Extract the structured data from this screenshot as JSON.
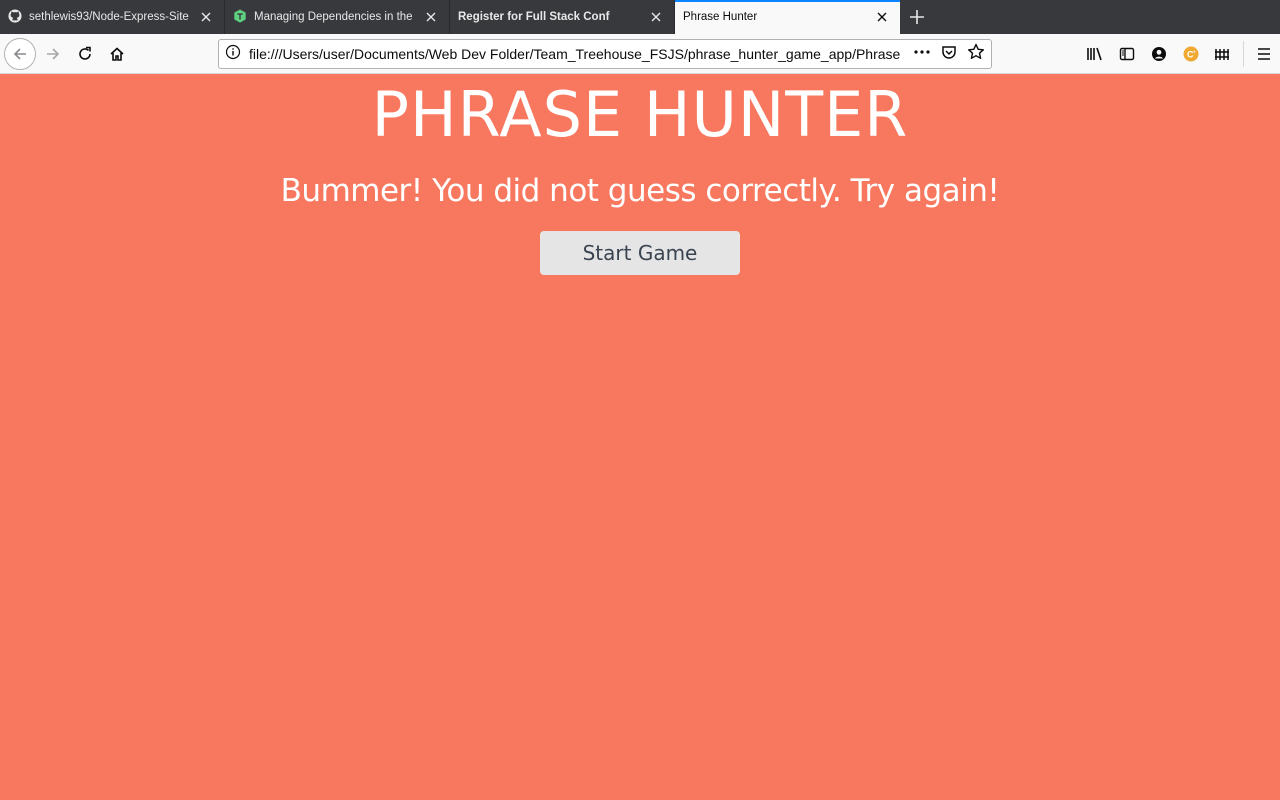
{
  "browser": {
    "tabs": [
      {
        "title": "sethlewis93/Node-Express-Site",
        "icon": "github-icon",
        "active": false,
        "bold": false
      },
      {
        "title": "Managing Dependencies in the",
        "icon": "treehouse-icon",
        "active": false,
        "bold": false
      },
      {
        "title": "Register for Full Stack Conf",
        "icon": "",
        "active": false,
        "bold": true
      },
      {
        "title": "Phrase Hunter",
        "icon": "",
        "active": true,
        "bold": false
      }
    ],
    "url": "file:///Users/user/Documents/Web Dev Folder/Team_Treehouse_FSJS/phrase_hunter_game_app/Phrase"
  },
  "game": {
    "title": "PHRASE HUNTER",
    "message": "Bummer! You did not guess correctly. Try again!",
    "start_button": "Start Game"
  },
  "colors": {
    "overlay_lose": "#f7785e",
    "button_bg": "#e5e5e5"
  }
}
